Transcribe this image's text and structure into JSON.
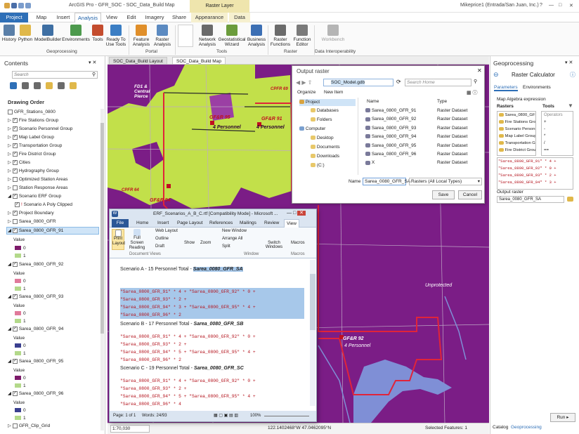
{
  "titlebar": {
    "left_title": "ArcGIS Pro - GFR_SOC - SOC_Data_Build Map",
    "context": "Raster Layer",
    "user": "Mikeprice1 (Entrada/San Juan, Inc.)",
    "help": "?",
    "min": "—",
    "max": "□",
    "close": "✕"
  },
  "tabs": [
    "Project",
    "Map",
    "Insert",
    "Analysis",
    "View",
    "Edit",
    "Imagery",
    "Share",
    "Appearance",
    "Data"
  ],
  "ribbon": {
    "buttons": [
      {
        "label": "History",
        "color": "#5a7fa8"
      },
      {
        "label": "Python",
        "color": "#e0b84a"
      },
      {
        "label": "ModelBuilder",
        "color": "#3e6fa3"
      },
      {
        "label": "Environments",
        "color": "#4d9a4d"
      },
      {
        "label": "Tools",
        "color": "#c44d2e"
      },
      {
        "label": "Ready To Use Tools",
        "color": "#3b7ec4"
      },
      {
        "label": "Feature Analysis",
        "color": "#e08f2a"
      },
      {
        "label": "Raster Analysis",
        "color": "#5b8ac1"
      },
      {
        "label": "Network Analysis",
        "color": "#6a6a6a"
      },
      {
        "label": "Geostatistical Wizard",
        "color": "#6b9c3c"
      },
      {
        "label": "Business Analysis",
        "color": "#3c6fb4"
      },
      {
        "label": "Raster Functions",
        "color": "#6b6b6b"
      },
      {
        "label": "Function Editor",
        "color": "#7a7a7a"
      },
      {
        "label": "Workbench",
        "color": "#b5b5b5"
      }
    ],
    "groups": [
      "Geoprocessing",
      "Portal",
      "Tools",
      "Raster",
      "Data Interoperability"
    ]
  },
  "contents": {
    "title": "Contents",
    "search_placeholder": "Search",
    "drawing_order": "Drawing Order",
    "layers": [
      "GFR_Stations_0800",
      "Fire Stations Group",
      "Scenario Personnel Group",
      "Map Label Group",
      "Transportation Group",
      "Fire District Group",
      "Cities",
      "Hydrography Group",
      "Optimized Station Areas",
      "Station Response Areas",
      "Scenario ERF Group",
      "Scenario A Poly Clipped",
      "Project Boundary",
      "Sarea_0800_GFR",
      "Sarea_0800_GFR_91"
    ],
    "raster_groups": [
      {
        "name": "Sarea_0800_GFR_92",
        "c0": "#e07a9b",
        "c1": "#b3d98a"
      },
      {
        "name": "Sarea_0800_GFR_93",
        "c0": "#e07a9b",
        "c1": "#b3d98a"
      },
      {
        "name": "Sarea_0800_GFR_94",
        "c0": "#3a3f8f",
        "c1": "#b3d98a"
      },
      {
        "name": "Sarea_0800_GFR_95",
        "c0": "#7d1a6a",
        "c1": "#b3d98a"
      },
      {
        "name": "Sarea_0800_GFR_96",
        "c0": "#3a3f8f",
        "c1": "#b3d98a"
      }
    ],
    "value_label": "Value",
    "v0": "0",
    "v1": "1",
    "last": "GFR_Clip_Grid"
  },
  "doc_tabs": [
    "SOC_Data_Build Layout",
    "SOC_Data_Build Map"
  ],
  "map": {
    "labels": [
      "FD1 & Central Pierce",
      "GF&R 95",
      "4 Personnel",
      "GF&R 91",
      "4 Personnel",
      "GF&R 94",
      "CPFR 69",
      "CPFR 64",
      "GF&R 92",
      "4 Personnel",
      "Unprotected"
    ],
    "colors": {
      "magenta": "#7b1d86",
      "lime": "#c2e04a",
      "boundary": "#e0243a",
      "water": "#7f8fd6"
    }
  },
  "status": {
    "scale": "1:70,030",
    "coords": "122.1402468°W 47.0462095°N",
    "selected": "Selected Features: 1"
  },
  "dialog": {
    "title": "Output raster",
    "path": "SOC_Model.gdb",
    "search_placeholder": "Search Home",
    "organize": "Organize",
    "new_item": "New Item",
    "tree": [
      "Project",
      "Databases",
      "Folders",
      "Computer",
      "Desktop",
      "Documents",
      "Downloads",
      "(C:)"
    ],
    "col_name": "Name",
    "col_type": "Type",
    "rows": [
      {
        "n": "Sarea_0800_GFR_91",
        "t": "Raster Dataset"
      },
      {
        "n": "Sarea_0800_GFR_92",
        "t": "Raster Dataset"
      },
      {
        "n": "Sarea_0800_GFR_93",
        "t": "Raster Dataset"
      },
      {
        "n": "Sarea_0800_GFR_94",
        "t": "Raster Dataset"
      },
      {
        "n": "Sarea_0800_GFR_95",
        "t": "Raster Dataset"
      },
      {
        "n": "Sarea_0800_GFR_96",
        "t": "Raster Dataset"
      },
      {
        "n": "X",
        "t": "Raster Dataset"
      }
    ],
    "name_label": "Name",
    "name_value": "Sarea_0080_GFR_SA",
    "filter": "Rasters (All Local Types)",
    "save": "Save",
    "cancel": "Cancel"
  },
  "word": {
    "title": "ERF_Scenarios_A_B_C.rtf [Compatibility Mode] - Microsoft ...",
    "tabs": [
      "File",
      "Home",
      "Insert",
      "Page Layout",
      "References",
      "Mailings",
      "Review",
      "View"
    ],
    "ribbon": [
      "Print Layout",
      "Full Screen Reading",
      "Web Layout",
      "Outline",
      "Draft",
      "Show",
      "Zoom",
      "New Window",
      "Arrange All",
      "Split",
      "Switch Windows",
      "Macros"
    ],
    "groups": [
      "Document Views",
      "Window",
      "Macros"
    ],
    "scenA": "Scenario A - 15 Personnel Total - ",
    "scenA_name": "Sarea_0080_GFR_SA",
    "exprA1": "\"Sarea_0800_GFR_91\" * 4 + \"Sarea_0800_GFR_92\" * 0 + \"Sarea_0800_GFR_93\" * 2 +",
    "exprA2": "\"Sarea_0800_GFR_94\" * 3 + \"Sarea_0800_GFR_95\" * 4 + \"Sarea_0800_GFR_96\" * 2",
    "scenB": "Scenario B - 17 Personnel Total - ",
    "scenB_name": "Sarea_0080_GFR_SB",
    "exprB1": "\"Sarea_0800_GFR_91\" * 4 + \"Sarea_0800_GFR_92\" * 0 + \"Sarea_0800_GFR_93\" * 2 +",
    "exprB2": "\"Sarea_0800_GFR_94\" * 5 + \"Sarea_0800_GFR_95\" * 4 + \"Sarea_0800_GFR_96\" * 2",
    "scenC": "Scenario C - 19 Personnel Total - ",
    "scenC_name": "Sarea_0080_GFR_SC",
    "exprC1": "\"Sarea_0800_GFR_91\" * 4 + \"Sarea_0800_GFR_92\" * 0 + \"Sarea_0800_GFR_93\" * 2 +",
    "exprC2": "\"Sarea_0800_GFR_94\" * 5 + \"Sarea_0800_GFR_95\" * 4 + \"Sarea_0800_GFR_96\" * 4",
    "page": "Page: 1 of 1",
    "words": "Words: 24/93",
    "zoom": "100%"
  },
  "geo": {
    "title": "Geoprocessing",
    "tool": "Raster Calculator",
    "tab_params": "Parameters",
    "tab_env": "Environments",
    "expr_label": "Map Algebra expression",
    "rasters": "Rasters",
    "tools": "Tools",
    "raster_items": [
      "Sarea_0800_GFR",
      "Fire Stations Group",
      "Scenario Personnel...",
      "Map Label Group",
      "Transportation Group",
      "Fire District Group"
    ],
    "operators": [
      "Operators",
      "+",
      "-",
      "*",
      "/",
      "=="
    ],
    "expr": [
      "\"Sarea_0800_GFR_91\" * 4 +",
      "\"Sarea_0800_GFR_92\" * 0 +",
      "\"Sarea_0800_GFR_93\" * 2 +",
      "\"Sarea_0800_GFR_94\" * 3 +"
    ],
    "out_label": "Output raster",
    "out_value": "Sarea_0080_GFR_SA",
    "run": "Run",
    "bottom_tabs": [
      "Catalog",
      "Geoprocessing"
    ]
  }
}
